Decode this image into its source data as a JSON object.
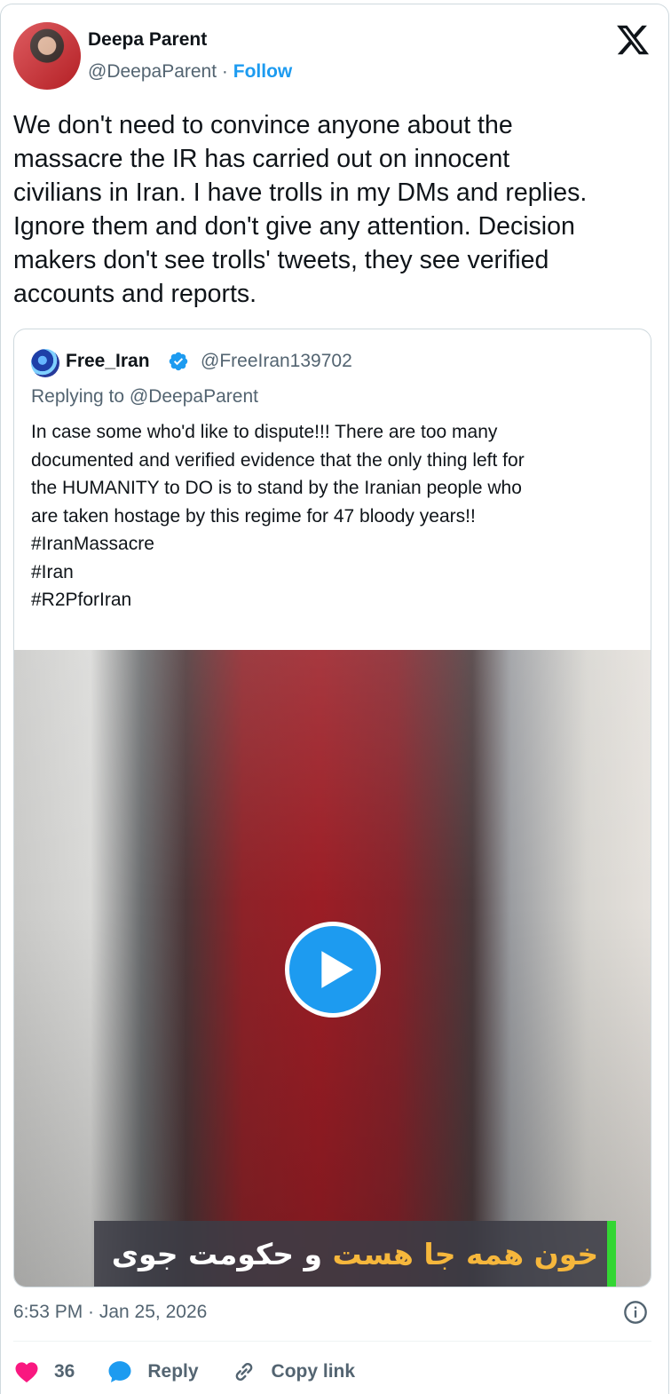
{
  "author": {
    "name": "Deepa Parent",
    "handle": "@DeepaParent",
    "separator": "·",
    "follow_label": "Follow"
  },
  "tweet": {
    "lines": [
      "We don't need to convince anyone about the",
      "massacre the IR has carried out on innocent",
      "civilians in Iran. I have trolls in my DMs and replies.",
      "Ignore them and don't give any attention. Decision",
      "makers don't see trolls' tweets, they see verified",
      "accounts and reports."
    ],
    "timestamp": "6:53 PM · Jan 25, 2026"
  },
  "quoted": {
    "name": "Free_Iran",
    "handle": "@FreeIran139702",
    "replying_to": "Replying to @DeepaParent",
    "lines": [
      "In case some who'd like to dispute!!! There are too many",
      "documented and verified evidence that the only thing left for",
      "the HUMANITY to DO is to stand by the Iranian people who",
      "are taken hostage by this regime for 47 bloody years!!",
      "#IranMassacre",
      "#Iran",
      "#R2PforIran"
    ],
    "video": {
      "caption_highlight": "خون همه جا هست",
      "caption_rest": " و حکومت جوی خون"
    }
  },
  "actions": {
    "likes": "36",
    "reply_label": "Reply",
    "copy_label": "Copy link"
  },
  "colors": {
    "accent": "#1d9bf0",
    "like": "#f91880",
    "muted": "#536471"
  }
}
